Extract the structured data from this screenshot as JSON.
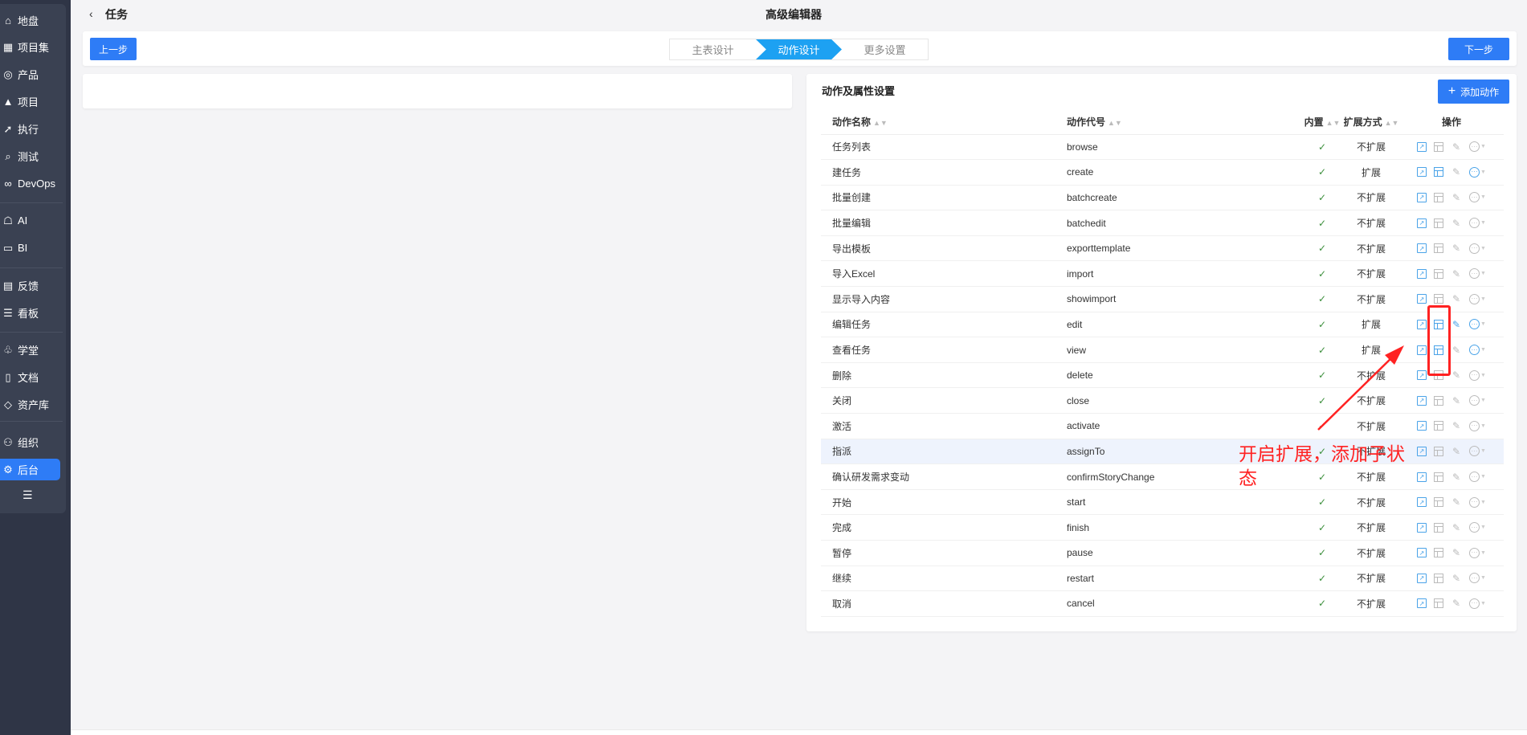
{
  "sidebar": {
    "items": [
      {
        "label": "地盘",
        "icon": "home-icon"
      },
      {
        "label": "项目集",
        "icon": "grid-icon"
      },
      {
        "label": "产品",
        "icon": "bulb-icon"
      },
      {
        "label": "项目",
        "icon": "rocket-icon"
      },
      {
        "label": "执行",
        "icon": "run-icon"
      },
      {
        "label": "测试",
        "icon": "search-icon"
      },
      {
        "label": "DevOps",
        "icon": "infinity-icon"
      },
      {
        "label": "AI",
        "icon": "robot-icon"
      },
      {
        "label": "BI",
        "icon": "chart-board-icon"
      },
      {
        "label": "反馈",
        "icon": "inbox-icon"
      },
      {
        "label": "看板",
        "icon": "kanban-icon"
      },
      {
        "label": "学堂",
        "icon": "school-icon"
      },
      {
        "label": "文档",
        "icon": "doc-icon"
      },
      {
        "label": "资产库",
        "icon": "diamond-icon"
      },
      {
        "label": "组织",
        "icon": "users-icon"
      },
      {
        "label": "后台",
        "icon": "gear-icon",
        "active": true
      }
    ]
  },
  "header": {
    "back": "‹",
    "module": "任务",
    "title": "高级编辑器"
  },
  "toolbar": {
    "prev": "上一步",
    "next": "下一步",
    "steps": [
      {
        "label": "主表设计"
      },
      {
        "label": "动作设计",
        "active": true
      },
      {
        "label": "更多设置"
      }
    ]
  },
  "panel": {
    "title": "动作及属性设置",
    "add_button": "添加动作",
    "add_icon": "+",
    "columns": [
      "动作名称",
      "动作代号",
      "内置",
      "扩展方式",
      "操作"
    ],
    "rows": [
      {
        "name": "任务列表",
        "code": "browse",
        "builtin": "✓",
        "ext": "不扩展"
      },
      {
        "name": "建任务",
        "code": "create",
        "builtin": "✓",
        "ext": "扩展"
      },
      {
        "name": "批量创建",
        "code": "batchcreate",
        "builtin": "✓",
        "ext": "不扩展"
      },
      {
        "name": "批量编辑",
        "code": "batchedit",
        "builtin": "✓",
        "ext": "不扩展"
      },
      {
        "name": "导出模板",
        "code": "exporttemplate",
        "builtin": "✓",
        "ext": "不扩展"
      },
      {
        "name": "导入Excel",
        "code": "import",
        "builtin": "✓",
        "ext": "不扩展"
      },
      {
        "name": "显示导入内容",
        "code": "showimport",
        "builtin": "✓",
        "ext": "不扩展"
      },
      {
        "name": "编辑任务",
        "code": "edit",
        "builtin": "✓",
        "ext": "扩展"
      },
      {
        "name": "查看任务",
        "code": "view",
        "builtin": "✓",
        "ext": "扩展"
      },
      {
        "name": "删除",
        "code": "delete",
        "builtin": "✓",
        "ext": "不扩展"
      },
      {
        "name": "关闭",
        "code": "close",
        "builtin": "✓",
        "ext": "不扩展"
      },
      {
        "name": "激活",
        "code": "activate",
        "builtin": "✓",
        "ext": "不扩展"
      },
      {
        "name": "指派",
        "code": "assignTo",
        "builtin": "✓",
        "ext": "不扩展"
      },
      {
        "name": "确认研发需求变动",
        "code": "confirmStoryChange",
        "builtin": "✓",
        "ext": "不扩展"
      },
      {
        "name": "开始",
        "code": "start",
        "builtin": "✓",
        "ext": "不扩展"
      },
      {
        "name": "完成",
        "code": "finish",
        "builtin": "✓",
        "ext": "不扩展"
      },
      {
        "name": "暂停",
        "code": "pause",
        "builtin": "✓",
        "ext": "不扩展"
      },
      {
        "name": "继续",
        "code": "restart",
        "builtin": "✓",
        "ext": "不扩展"
      },
      {
        "name": "取消",
        "code": "cancel",
        "builtin": "✓",
        "ext": "不扩展"
      }
    ]
  },
  "annotation": {
    "text": "开启扩展，添加子状态",
    "color": "#ff2222"
  },
  "colors": {
    "primary": "#2e7cf6",
    "step_active": "#1da1f2",
    "sidebar": "#2f3546"
  }
}
